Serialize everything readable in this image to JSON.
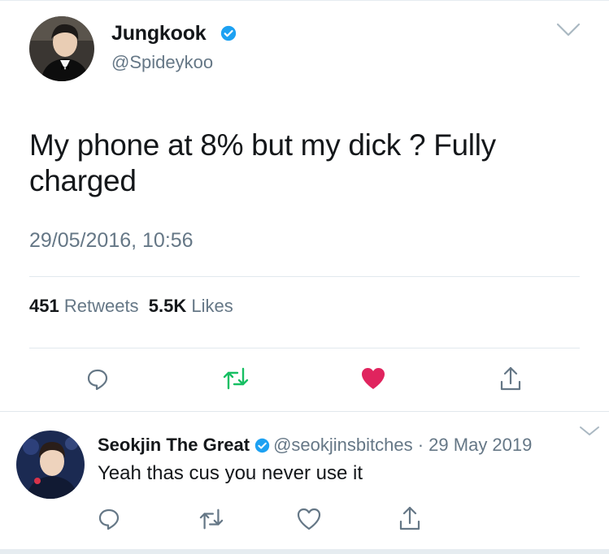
{
  "tweet": {
    "author_name": "Jungkook",
    "handle": "@Spideykoo",
    "text": "My phone at 8% but my dick ?   Fully charged",
    "timestamp": "29/05/2016, 10:56",
    "retweets_count": "451",
    "retweets_label": "Retweets",
    "likes_count": "5.5K",
    "likes_label": "Likes",
    "liked": true
  },
  "reply": {
    "author_name": "Seokjin The Great",
    "handle": "@seokjinsbitches",
    "separator": "·",
    "date": "29 May 2019",
    "text": "Yeah thas cus you never use it"
  },
  "colors": {
    "verified": "#1da1f2",
    "retweet_green": "#17bf63",
    "like_red": "#e0245e",
    "icon_gray": "#657786",
    "text_secondary": "#657786"
  },
  "icons": {
    "reply": "speech-bubble",
    "retweet": "retweet-arrows",
    "like": "heart",
    "share": "share-upload",
    "menu": "chevron-down",
    "verified": "verified-badge"
  }
}
